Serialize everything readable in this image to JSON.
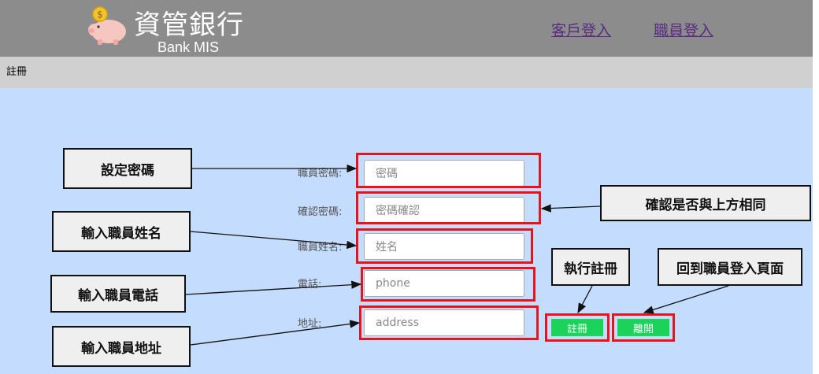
{
  "header": {
    "title": "資管銀行",
    "subtitle": "Bank MIS",
    "logo_icon": "piggy-bank-icon",
    "nav": [
      {
        "label": "客戶登入"
      },
      {
        "label": "職員登入"
      }
    ]
  },
  "subbar": {
    "title": "註冊"
  },
  "form": {
    "password": {
      "label": "職員密碼:",
      "placeholder": "密碼"
    },
    "confirm": {
      "label": "確認密碼:",
      "placeholder": "密碼確認"
    },
    "name": {
      "label": "職員姓名:",
      "placeholder": "姓名"
    },
    "phone": {
      "label": "電話:",
      "placeholder": "phone"
    },
    "address": {
      "label": "地址:",
      "placeholder": "address"
    },
    "register_label": "註冊",
    "leave_label": "離開"
  },
  "annotations": {
    "set_password": "設定密碼",
    "confirm_same": "確認是否與上方相同",
    "enter_name": "輸入職員姓名",
    "enter_phone": "輸入職員電話",
    "enter_address": "輸入職員地址",
    "do_register": "執行註冊",
    "back_to_login": "回到職員登入頁面"
  },
  "colors": {
    "header_bg": "#8c8c8c",
    "subbar_bg": "#d0d0d0",
    "main_bg": "#c4dcfd",
    "button_green": "#1bd35a",
    "highlight_red": "#e8141c",
    "link_purple": "#5a2a82"
  }
}
